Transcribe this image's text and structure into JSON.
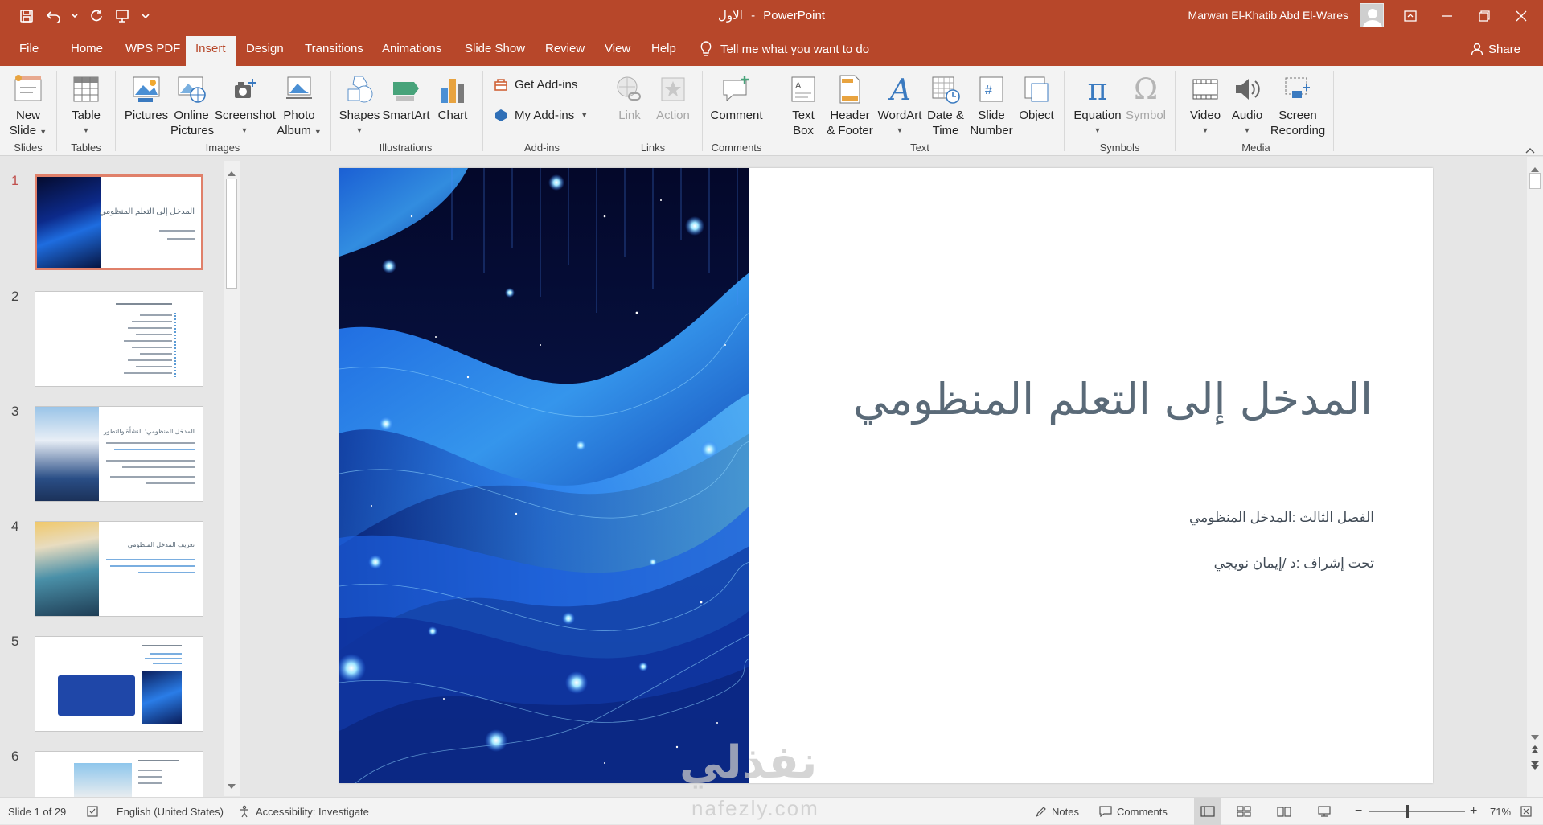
{
  "window": {
    "doc_title": "الاول",
    "app_name": "PowerPoint",
    "title_sep": "-",
    "user_name": "Marwan El-Khatib Abd El-Wares"
  },
  "tabs": [
    {
      "label": "File"
    },
    {
      "label": "Home"
    },
    {
      "label": "WPS PDF"
    },
    {
      "label": "Insert"
    },
    {
      "label": "Design"
    },
    {
      "label": "Transitions"
    },
    {
      "label": "Animations"
    },
    {
      "label": "Slide Show"
    },
    {
      "label": "Review"
    },
    {
      "label": "View"
    },
    {
      "label": "Help"
    }
  ],
  "active_tab": "Insert",
  "tell_me": "Tell me what you want to do",
  "share": "Share",
  "ribbon": {
    "new_slide": [
      "New",
      "Slide"
    ],
    "table": "Table",
    "pictures": "Pictures",
    "online_pictures": [
      "Online",
      "Pictures"
    ],
    "screenshot": "Screenshot",
    "photo_album": [
      "Photo",
      "Album"
    ],
    "shapes": "Shapes",
    "smartart": "SmartArt",
    "chart": "Chart",
    "get_addins": "Get Add-ins",
    "my_addins": "My Add-ins",
    "link": "Link",
    "action": "Action",
    "comment": "Comment",
    "text_box": [
      "Text",
      "Box"
    ],
    "header_footer": [
      "Header",
      "& Footer"
    ],
    "wordart": "WordArt",
    "date_time": [
      "Date &",
      "Time"
    ],
    "slide_number": [
      "Slide",
      "Number"
    ],
    "object": "Object",
    "equation": "Equation",
    "symbol": "Symbol",
    "video": "Video",
    "audio": "Audio",
    "screen_recording": [
      "Screen",
      "Recording"
    ],
    "groups": {
      "slides": "Slides",
      "tables": "Tables",
      "images": "Images",
      "illustrations": "Illustrations",
      "addins": "Add-ins",
      "links": "Links",
      "comments": "Comments",
      "text": "Text",
      "symbols": "Symbols",
      "media": "Media"
    }
  },
  "thumbnails": [
    "1",
    "2",
    "3",
    "4",
    "5",
    "6"
  ],
  "slide": {
    "title": "المدخل إلى التعلم المنظومي",
    "subtitle1": "الفصل الثالث :المدخل المنظومي",
    "subtitle2": "تحت إشراف :د /إيمان نويجي"
  },
  "thumb_text": {
    "s1": "المدخل إلى التعلم المنظومي",
    "s3": "المدخل المنظومي: النشأة والتطور",
    "s4": "تعريف المدخل المنظومي"
  },
  "status": {
    "slide_of": "Slide 1 of 29",
    "language": "English (United States)",
    "accessibility": "Accessibility: Investigate",
    "notes": "Notes",
    "comments": "Comments",
    "zoom": "71%"
  },
  "watermark": {
    "arabic": "نفذلي",
    "latin": "nafezly.com"
  },
  "colors": {
    "accent": "#b7472a",
    "ribbon_bg": "#f3f3f3",
    "pane_bg": "#e6e6e6"
  }
}
